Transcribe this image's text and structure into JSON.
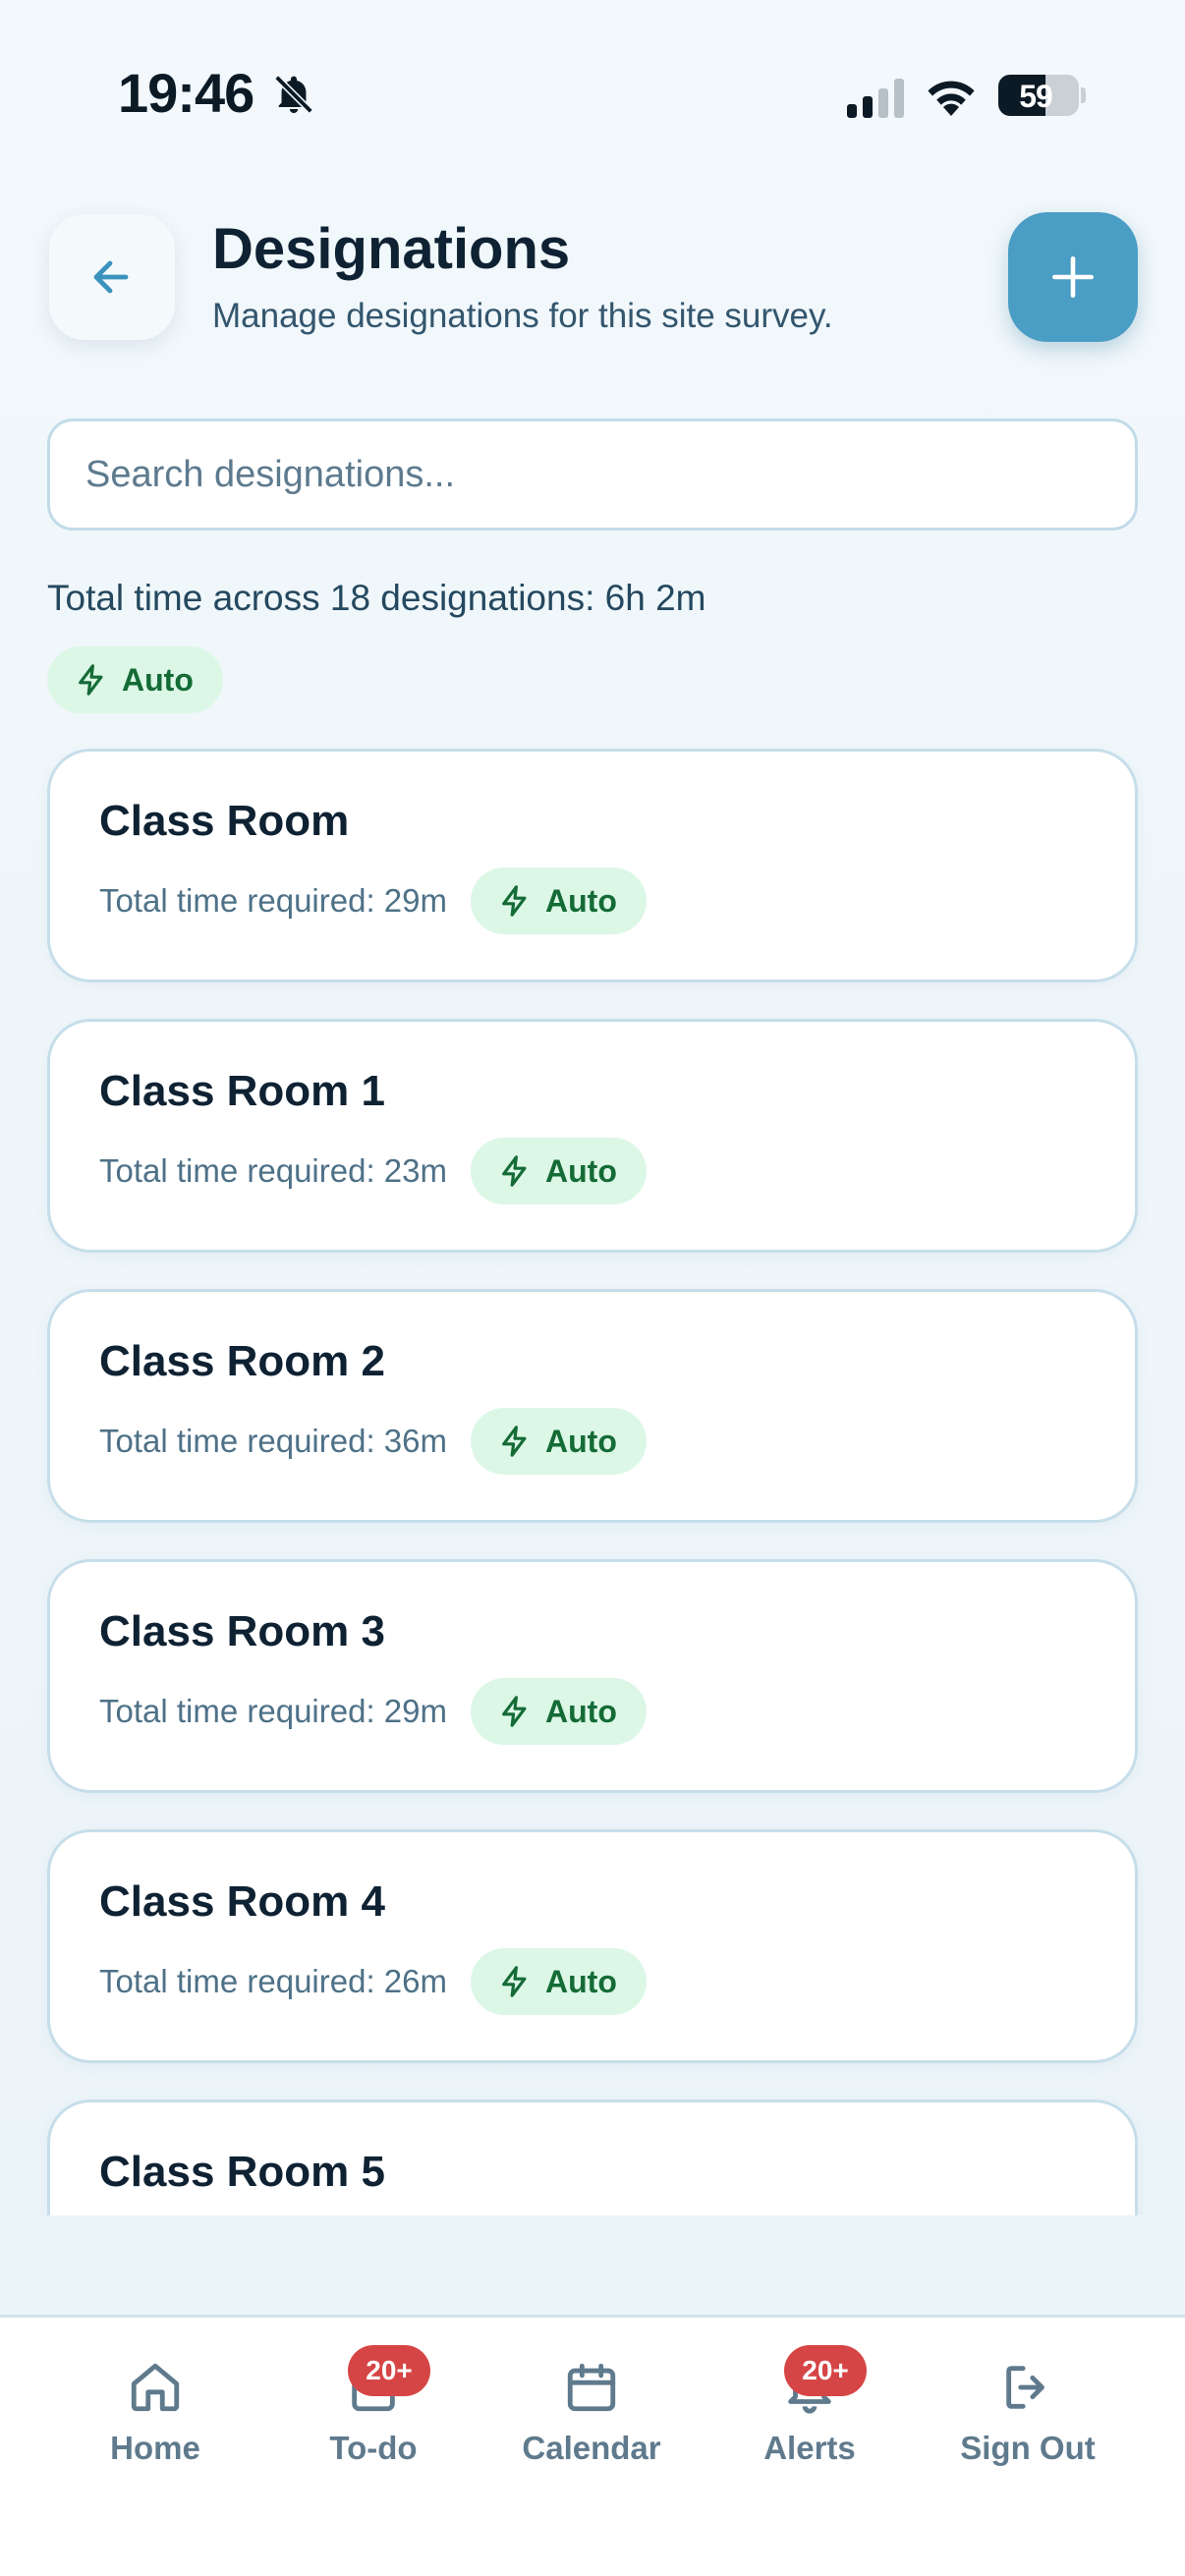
{
  "status_bar": {
    "time": "19:46",
    "battery": "59"
  },
  "header": {
    "title": "Designations",
    "subtitle": "Manage designations for this site survey."
  },
  "search": {
    "placeholder": "Search designations...",
    "value": ""
  },
  "summary": {
    "total_text": "Total time across 18 designations: 6h 2m",
    "badge": "Auto"
  },
  "designations": [
    {
      "name": "Class Room",
      "time": "Total time required: 29m",
      "badge": "Auto"
    },
    {
      "name": "Class Room 1",
      "time": "Total time required: 23m",
      "badge": "Auto"
    },
    {
      "name": "Class Room 2",
      "time": "Total time required: 36m",
      "badge": "Auto"
    },
    {
      "name": "Class Room 3",
      "time": "Total time required: 29m",
      "badge": "Auto"
    },
    {
      "name": "Class Room 4",
      "time": "Total time required: 26m",
      "badge": "Auto"
    },
    {
      "name": "Class Room 5",
      "time": "",
      "badge": ""
    }
  ],
  "nav": {
    "home": {
      "label": "Home"
    },
    "todo": {
      "label": "To-do",
      "badge": "20+"
    },
    "calendar": {
      "label": "Calendar"
    },
    "alerts": {
      "label": "Alerts",
      "badge": "20+"
    },
    "signout": {
      "label": "Sign Out"
    }
  },
  "colors": {
    "accent": "#4a9dc4",
    "badge_bg": "#dcf7e6",
    "badge_text": "#146b36",
    "alert": "#d64545"
  }
}
